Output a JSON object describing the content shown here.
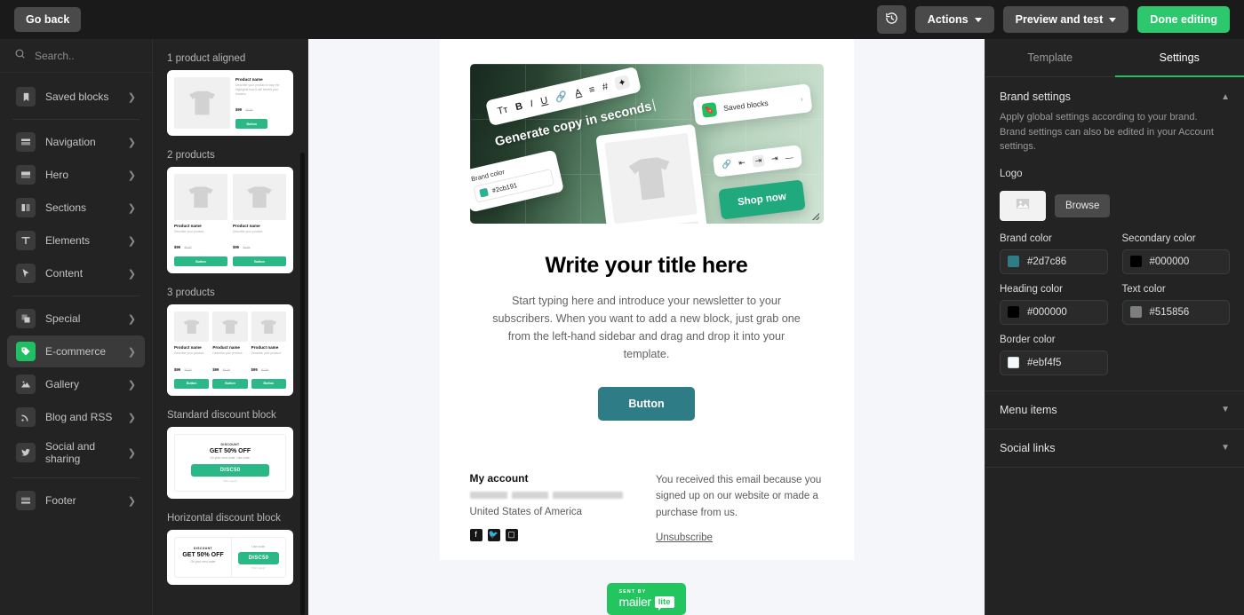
{
  "topbar": {
    "go_back": "Go back",
    "history_icon": "history-revert-icon",
    "actions": "Actions",
    "preview": "Preview and test",
    "done": "Done editing"
  },
  "sidebar": {
    "search_placeholder": "Search..",
    "groups": [
      {
        "items": [
          {
            "label": "Saved blocks",
            "icon": "bookmark-icon",
            "active": false
          }
        ]
      },
      {
        "items": [
          {
            "label": "Navigation",
            "icon": "navigation-block-icon",
            "active": false
          },
          {
            "label": "Hero",
            "icon": "hero-block-icon",
            "active": false
          },
          {
            "label": "Sections",
            "icon": "columns-icon",
            "active": false
          },
          {
            "label": "Elements",
            "icon": "text-type-icon",
            "active": false
          },
          {
            "label": "Content",
            "icon": "cursor-pointer-icon",
            "active": false
          }
        ]
      },
      {
        "items": [
          {
            "label": "Special",
            "icon": "layers-icon",
            "active": false
          },
          {
            "label": "E-commerce",
            "icon": "price-tag-icon",
            "active": true
          },
          {
            "label": "Gallery",
            "icon": "image-icon",
            "active": false
          },
          {
            "label": "Blog and RSS",
            "icon": "rss-icon",
            "active": false
          },
          {
            "label": "Social and sharing",
            "icon": "twitter-bird-icon",
            "active": false
          }
        ]
      },
      {
        "items": [
          {
            "label": "Footer",
            "icon": "footer-block-icon",
            "active": false
          }
        ]
      }
    ]
  },
  "blocks": {
    "groups": [
      {
        "title": "1 product aligned",
        "type": "product1"
      },
      {
        "title": "2 products",
        "type": "product2"
      },
      {
        "title": "3 products",
        "type": "product3"
      },
      {
        "title": "Standard discount block",
        "type": "discount-standard"
      },
      {
        "title": "Horizontal discount block",
        "type": "discount-horizontal"
      }
    ],
    "product": {
      "name": "Product name",
      "desc_long": "Describe your product in way the highlights how it will benefit your readers.",
      "desc_short": "Describe your product.",
      "price": "$99",
      "old_price": "$129",
      "button": "Button"
    },
    "discount": {
      "kicker": "DISCOUNT",
      "headline": "GET 50% OFF",
      "sub": "On your next order. Use code:",
      "sub_short": "On your next order",
      "use_code": "Use code:",
      "code": "DISC50",
      "terms": "T&C's apply*"
    }
  },
  "canvas": {
    "hero": {
      "toolbar_icons": [
        "Tт",
        "B",
        "I",
        "U",
        "link-icon",
        "A",
        "align-icon",
        "#",
        "ai-sparkle-icon"
      ],
      "generate_copy": "Generate copy in seconds",
      "brand_color_label": "Brand color",
      "brand_color_value": "#2cb191",
      "saved_blocks": "Saved blocks",
      "align_icons": [
        "link-icon",
        "align-left-icon",
        "align-center-icon",
        "align-right-icon",
        "align-justify-icon"
      ],
      "shop_now": "Shop now"
    },
    "title": "Write your title here",
    "body": "Start typing here and introduce your newsletter to your subscribers. When you want to add a new block, just grab one from the left-hand sidebar and drag and drop it into your template.",
    "button": "Button",
    "footer": {
      "account_heading": "My account",
      "address": "United States of America",
      "socials": [
        "facebook-icon",
        "twitter-icon",
        "instagram-icon"
      ],
      "disclaimer": "You received this email because you signed up on our website or made a purchase from us.",
      "unsubscribe": "Unsubscribe"
    },
    "badge": {
      "sent_by": "SENT BY",
      "name": "mailer",
      "lite": "lite"
    }
  },
  "settings": {
    "tabs": [
      {
        "label": "Template",
        "active": false
      },
      {
        "label": "Settings",
        "active": true
      }
    ],
    "brand": {
      "title": "Brand settings",
      "description": "Apply global settings according to your brand. Brand settings can also be edited in your Account settings.",
      "logo_label": "Logo",
      "logo_icon": "image-placeholder-icon",
      "browse": "Browse",
      "colors": [
        {
          "label": "Brand color",
          "value": "#2d7c86",
          "swatch": "#2d7c86"
        },
        {
          "label": "Secondary color",
          "value": "#000000",
          "swatch": "#000000"
        },
        {
          "label": "Heading color",
          "value": "#000000",
          "swatch": "#000000"
        },
        {
          "label": "Text color",
          "value": "#515856",
          "swatch": "#7b7f7e"
        },
        {
          "label": "Border color",
          "value": "#ebf4f5",
          "swatch": "#f4fafb"
        }
      ]
    },
    "sections": [
      {
        "label": "Menu items"
      },
      {
        "label": "Social links"
      }
    ]
  }
}
